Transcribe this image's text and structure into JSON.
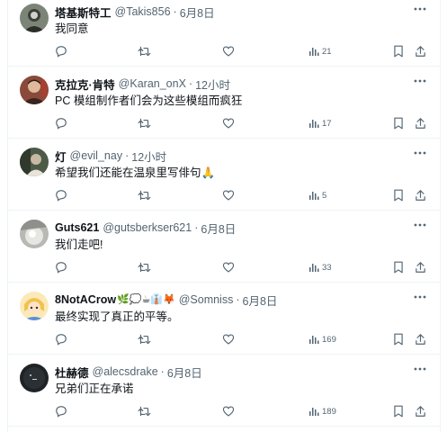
{
  "replies": [
    {
      "name": "塔基斯特工",
      "handle": "@Takis856",
      "time": "6月8日",
      "text": "我同意",
      "views": "21"
    },
    {
      "name": "克拉克·肯特",
      "handle": "@Karan_onX",
      "time": "12小时",
      "text": "PC 模组制作者们会为这些模组而疯狂",
      "views": "17"
    },
    {
      "name": "灯",
      "handle": "@evil_nay",
      "time": "12小时",
      "text": "希望我们还能在温泉里写俳句🙏",
      "views": "5"
    },
    {
      "name": "Guts621",
      "handle": "@gutsberkser621",
      "time": "6月8日",
      "text": "我们走吧!",
      "views": "33"
    },
    {
      "name": "NotACrow",
      "name_prefix": "8",
      "name_emojis": "🌿💭☕👔🦊",
      "handle": "@Somniss",
      "time": "6月8日",
      "text": "最终实现了真正的平等。",
      "views": "169"
    },
    {
      "name": "杜赫德",
      "handle": "@alecsdrake",
      "time": "6月8日",
      "text": "兄弟们正在承诺",
      "views": "189"
    }
  ],
  "icons": {
    "more": "more-horizontal-icon",
    "reply": "reply-icon",
    "retweet": "retweet-icon",
    "like": "heart-icon",
    "views": "views-bar-chart-icon",
    "bookmark": "bookmark-icon",
    "share": "share-upload-icon"
  },
  "colors": {
    "text_primary": "#0f1419",
    "text_secondary": "#536471",
    "divider": "#eff3f4",
    "background": "#ffffff"
  }
}
